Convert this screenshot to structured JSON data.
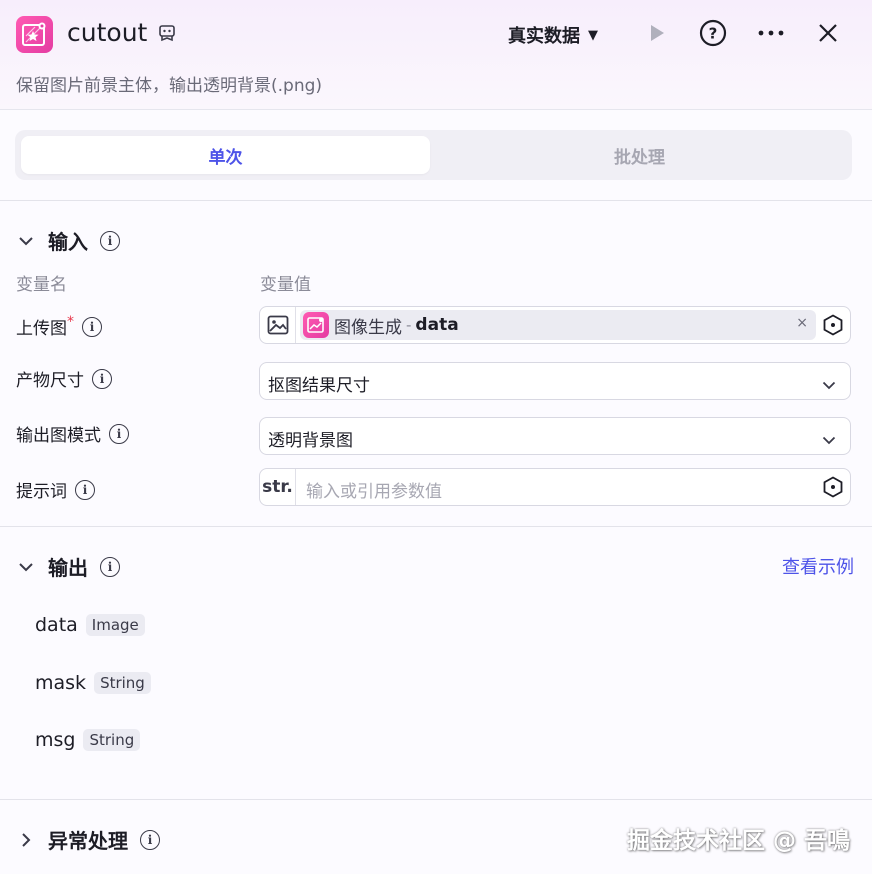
{
  "header": {
    "title": "cutout",
    "subtitle": "保留图片前景主体，输出透明背景(.png)",
    "env_select": "真实数据",
    "icons": [
      "app-icon",
      "template-icon",
      "play-icon",
      "help-icon",
      "more-icon",
      "close-icon"
    ]
  },
  "mode_tabs": [
    {
      "label": "单次",
      "active": true
    },
    {
      "label": "批处理",
      "active": false
    }
  ],
  "input_section": {
    "title": "输入",
    "col_name": "变量名",
    "col_value": "变量值",
    "rows": [
      {
        "label": "上传图",
        "required_mark": "*",
        "type_icon": "image-icon",
        "ref_node": "图像生成",
        "ref_sep": "-",
        "ref_var": "data",
        "clear": "×"
      },
      {
        "label": "产物尺寸",
        "value": "抠图结果尺寸"
      },
      {
        "label": "输出图模式",
        "value": "透明背景图"
      },
      {
        "label": "提示词",
        "type_label": "str.",
        "placeholder": "输入或引用参数值"
      }
    ]
  },
  "output_section": {
    "title": "输出",
    "link": "查看示例",
    "items": [
      {
        "name": "data",
        "type": "Image"
      },
      {
        "name": "mask",
        "type": "String"
      },
      {
        "name": "msg",
        "type": "String"
      }
    ]
  },
  "exception_section": {
    "title": "异常处理"
  },
  "watermark": "掘金技术社区 @ 吾鳴",
  "colors": {
    "accent": "#4d53e8",
    "brand_pink": "#e43ca2",
    "required": "#e6374b"
  }
}
